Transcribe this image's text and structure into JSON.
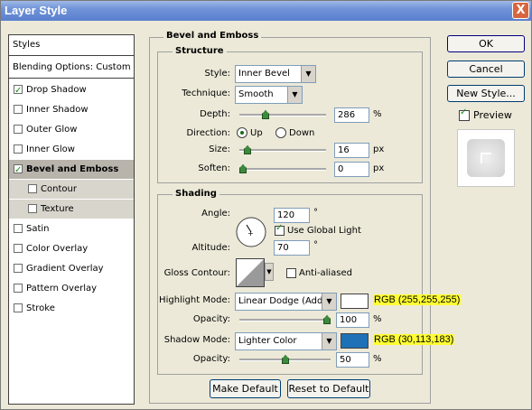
{
  "window": {
    "title": "Layer Style",
    "close_label": "X"
  },
  "styles_panel": {
    "header": "Styles",
    "blending": "Blending Options: Custom",
    "items": [
      {
        "label": "Drop Shadow",
        "checked": true
      },
      {
        "label": "Inner Shadow",
        "checked": false
      },
      {
        "label": "Outer Glow",
        "checked": false
      },
      {
        "label": "Inner Glow",
        "checked": false
      },
      {
        "label": "Bevel and Emboss",
        "checked": true,
        "selected": true
      },
      {
        "label": "Contour",
        "checked": false,
        "sub": true
      },
      {
        "label": "Texture",
        "checked": false,
        "sub": true
      },
      {
        "label": "Satin",
        "checked": false
      },
      {
        "label": "Color Overlay",
        "checked": false
      },
      {
        "label": "Gradient Overlay",
        "checked": false
      },
      {
        "label": "Pattern Overlay",
        "checked": false
      },
      {
        "label": "Stroke",
        "checked": false
      }
    ]
  },
  "bevel": {
    "title": "Bevel and Emboss",
    "structure": {
      "title": "Structure",
      "style_label": "Style:",
      "style_value": "Inner Bevel",
      "technique_label": "Technique:",
      "technique_value": "Smooth",
      "depth_label": "Depth:",
      "depth_value": "286",
      "depth_unit": "%",
      "depth_level": 0.286,
      "direction_label": "Direction:",
      "dir_up": "Up",
      "dir_down": "Down",
      "direction_selected": "Up",
      "size_label": "Size:",
      "size_value": "16",
      "size_unit": "px",
      "size_level": 0.06,
      "soften_label": "Soften:",
      "soften_value": "0",
      "soften_unit": "px",
      "soften_level": 0
    },
    "shading": {
      "title": "Shading",
      "angle_label": "Angle:",
      "angle_value": "120",
      "angle_unit": "°",
      "global_light_label": "Use Global Light",
      "global_light_checked": true,
      "altitude_label": "Altitude:",
      "altitude_value": "70",
      "altitude_unit": "°",
      "gloss_label": "Gloss Contour:",
      "antialiased_label": "Anti-aliased",
      "antialiased_checked": false,
      "highlight_mode_label": "Highlight Mode:",
      "highlight_mode_value": "Linear Dodge (Add)",
      "highlight_color": "#ffffff",
      "highlight_rgb_text": "RGB (255,255,255)",
      "highlight_opacity_label": "Opacity:",
      "highlight_opacity_value": "100",
      "highlight_opacity_unit": "%",
      "highlight_opacity_level": 1.0,
      "shadow_mode_label": "Shadow Mode:",
      "shadow_mode_value": "Lighter Color",
      "shadow_color": "#1e71b7",
      "shadow_rgb_text": "RGB (30,113,183)",
      "shadow_opacity_label": "Opacity:",
      "shadow_opacity_value": "50",
      "shadow_opacity_unit": "%",
      "shadow_opacity_level": 0.5
    },
    "make_default": "Make Default",
    "reset_default": "Reset to Default"
  },
  "buttons": {
    "ok": "OK",
    "cancel": "Cancel",
    "new_style": "New Style...",
    "preview_label": "Preview",
    "preview_checked": true
  },
  "colors": {
    "highlight_marker": "#ffff33",
    "title_bar": "#5a7fcf"
  }
}
